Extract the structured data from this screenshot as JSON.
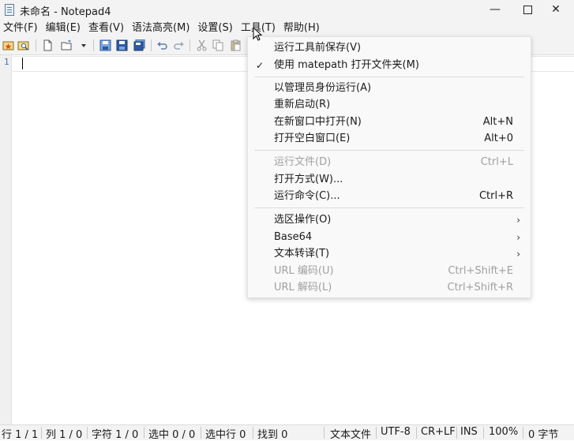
{
  "window": {
    "title": "未命名 - Notepad4",
    "minimize": "—",
    "close": "✕"
  },
  "menubar": [
    {
      "label": "文件(F)"
    },
    {
      "label": "编辑(E)"
    },
    {
      "label": "查看(V)"
    },
    {
      "label": "语法高亮(M)"
    },
    {
      "label": "设置(S)"
    },
    {
      "label": "工具(T)"
    },
    {
      "label": "帮助(H)"
    }
  ],
  "toolbar": {
    "icons": [
      "favorites-icon",
      "find-file-icon",
      "new-file-icon",
      "open-file-icon",
      "dropdown-icon",
      "save-icon",
      "save-as-icon",
      "save-copy-icon",
      "undo-icon",
      "redo-icon",
      "cut-icon",
      "copy-icon",
      "paste-icon"
    ]
  },
  "editor": {
    "line_number": "1"
  },
  "tools_menu": {
    "items": [
      {
        "label": "运行工具前保存(V)",
        "shortcut": "",
        "checked": false,
        "disabled": false,
        "submenu": false
      },
      {
        "label": "使用 matepath 打开文件夹(M)",
        "shortcut": "",
        "checked": true,
        "disabled": false,
        "submenu": false
      },
      {
        "label": "以管理员身份运行(A)",
        "shortcut": "",
        "checked": false,
        "disabled": false,
        "submenu": false
      },
      {
        "label": "重新启动(R)",
        "shortcut": "",
        "checked": false,
        "disabled": false,
        "submenu": false
      },
      {
        "label": "在新窗口中打开(N)",
        "shortcut": "Alt+N",
        "checked": false,
        "disabled": false,
        "submenu": false
      },
      {
        "label": "打开空白窗口(E)",
        "shortcut": "Alt+0",
        "checked": false,
        "disabled": false,
        "submenu": false
      },
      {
        "label": "运行文件(D)",
        "shortcut": "Ctrl+L",
        "checked": false,
        "disabled": true,
        "submenu": false
      },
      {
        "label": "打开方式(W)...",
        "shortcut": "",
        "checked": false,
        "disabled": false,
        "submenu": false
      },
      {
        "label": "运行命令(C)...",
        "shortcut": "Ctrl+R",
        "checked": false,
        "disabled": false,
        "submenu": false
      },
      {
        "label": "选区操作(O)",
        "shortcut": "",
        "checked": false,
        "disabled": false,
        "submenu": true
      },
      {
        "label": "Base64",
        "shortcut": "",
        "checked": false,
        "disabled": false,
        "submenu": true
      },
      {
        "label": "文本转译(T)",
        "shortcut": "",
        "checked": false,
        "disabled": false,
        "submenu": true
      },
      {
        "label": "URL 编码(U)",
        "shortcut": "Ctrl+Shift+E",
        "checked": false,
        "disabled": true,
        "submenu": false
      },
      {
        "label": "URL 解码(L)",
        "shortcut": "Ctrl+Shift+R",
        "checked": false,
        "disabled": true,
        "submenu": false
      }
    ],
    "check_glyph": "✓",
    "arrow_glyph": "›"
  },
  "statusbar": {
    "line": "行 1 / 1",
    "col": "列 1 / 0",
    "char": "字符 1 / 0",
    "sel": "选中 0 / 0",
    "sel_lines": "选中行 0",
    "found": "找到 0",
    "doc_type": "文本文件",
    "encoding": "UTF-8",
    "eol": "CR+LF",
    "ins": "INS",
    "zoom": "100%",
    "bytes": "0 字节"
  },
  "colors": {
    "accent": "#2b79c8",
    "disabled_text": "#a0a0a0"
  }
}
